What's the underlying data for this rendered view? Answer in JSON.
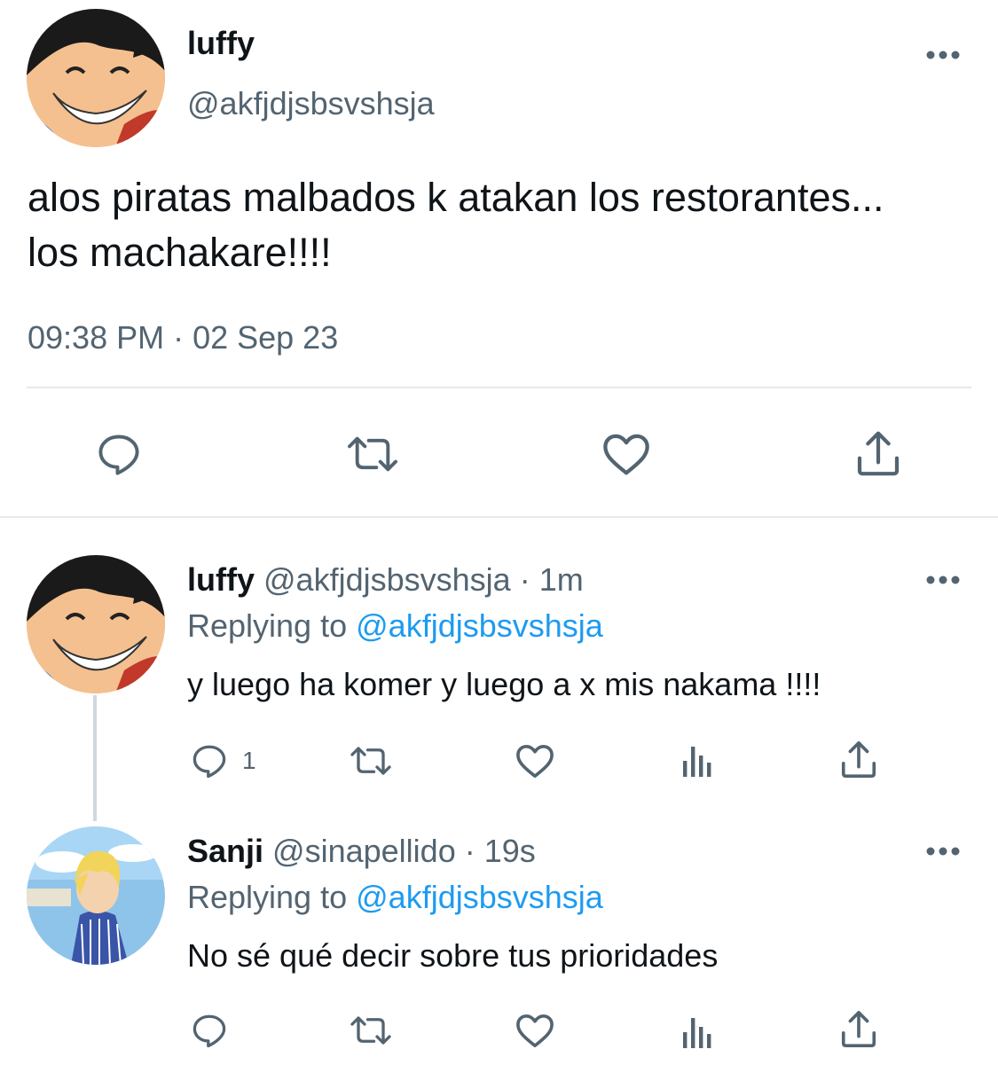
{
  "main_tweet": {
    "author_name": "luffy",
    "author_handle": "@akfjdjsbsvshsja",
    "avatar_icon": "luffy-avatar",
    "text": "alos piratas malbados k atakan los restorantes... los machakare!!!!",
    "timestamp": "09:38 PM · 02 Sep 23",
    "actions": [
      "reply-icon",
      "retweet-icon",
      "like-icon",
      "share-icon"
    ]
  },
  "replies": [
    {
      "author_name": "luffy",
      "author_handle": "@akfjdjsbsvshsja",
      "time": "1m",
      "replying_prefix": "Replying to",
      "replying_to": "@akfjdjsbsvshsja",
      "text": "y luego ha komer y luego a x mis nakama !!!!",
      "reply_count": "1",
      "avatar_icon": "luffy-avatar"
    },
    {
      "author_name": "Sanji",
      "author_handle": "@sinapellido",
      "time": "19s",
      "replying_prefix": "Replying to",
      "replying_to": "@akfjdjsbsvshsja",
      "text": "No sé qué decir sobre tus prioridades",
      "reply_count": "",
      "avatar_icon": "sanji-avatar"
    }
  ],
  "colors": {
    "text": "#0f1419",
    "secondary": "#536471",
    "link": "#1d9bf0",
    "divider": "#e6e9eb"
  }
}
